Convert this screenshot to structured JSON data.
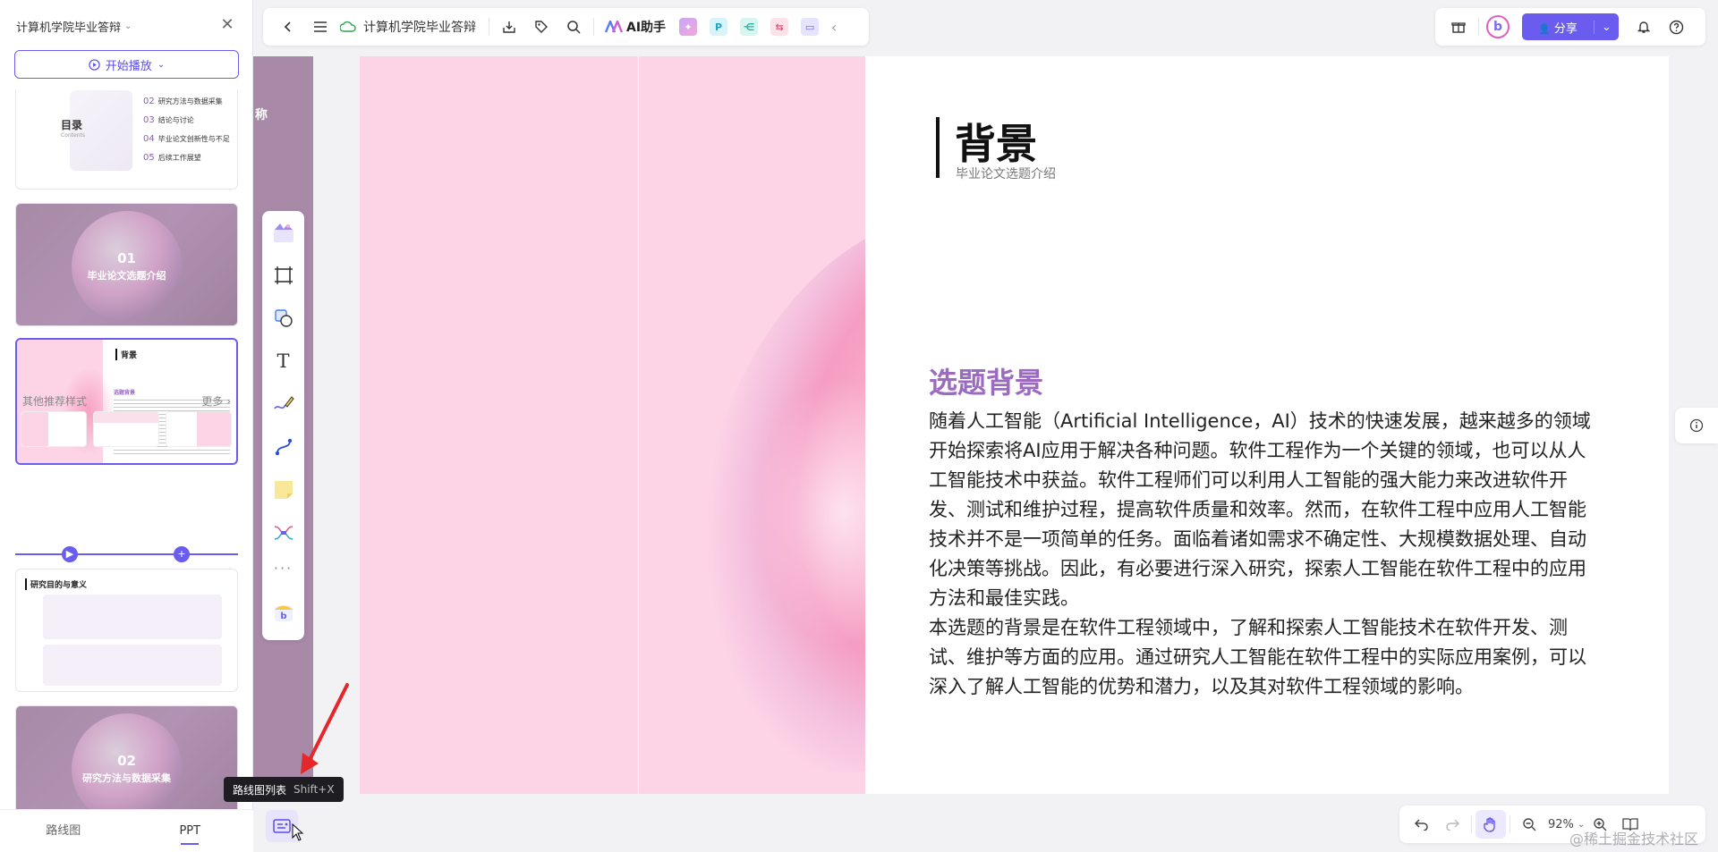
{
  "sidebar": {
    "title": "计算机学院毕业答辩",
    "play_label": "开始播放",
    "toc": {
      "title": "目录",
      "subtitle": "Contents",
      "items": [
        {
          "num": "02",
          "label": "研究方法与数据采集"
        },
        {
          "num": "03",
          "label": "结论与讨论"
        },
        {
          "num": "04",
          "label": "毕业论文创新性与不足"
        },
        {
          "num": "05",
          "label": "后续工作展望"
        }
      ]
    },
    "slide_01": {
      "num": "01",
      "label": "毕业论文选题介绍"
    },
    "slide_active": {
      "title": "背景",
      "section": "选题背景"
    },
    "recommend": {
      "label": "其他推荐样式",
      "more": "更多"
    },
    "slide_purpose": {
      "title": "研究目的与意义"
    },
    "slide_02": {
      "num": "02",
      "label": "研究方法与数据采集"
    },
    "tabs": [
      "路线图",
      "PPT"
    ]
  },
  "topbar": {
    "doc_title": "计算机学院毕业答辩",
    "ai_label": "AI助手"
  },
  "topright": {
    "share_label": "分享",
    "avatar_letter": "b"
  },
  "slide": {
    "strip_char": "称",
    "title": "背景",
    "subtitle": "毕业论文选题介绍",
    "section_title": "选题背景",
    "paragraphs": [
      "随着人工智能（Artificial Intelligence，AI）技术的快速发展，越来越多的领域开始探索将AI应用于解决各种问题。软件工程作为一个关键的领域，也可以从人工智能技术中获益。软件工程师们可以利用人工智能的强大能力来改进软件开发、测试和维护过程，提高软件质量和效率。然而，在软件工程中应用人工智能技术并不是一项简单的任务。面临着诸如需求不确定性、大规模数据处理、自动化决策等挑战。因此，有必要进行深入研究，探索人工智能在软件工程中的应用方法和最佳实践。",
      "本选题的背景是在软件工程领域中，了解和探索人工智能技术在软件开发、测试、维护等方面的应用。通过研究人工智能在软件工程中的实际应用案例，可以深入了解人工智能的优势和潜力，以及其对软件工程领域的影响。"
    ]
  },
  "tooltip": {
    "label": "路线图列表",
    "shortcut": "Shift+X"
  },
  "zoom": {
    "value": "92%"
  },
  "watermark": "@稀土掘金技术社区",
  "colors": {
    "accent": "#6b5cf0",
    "slide_pink": "#fdd4e6",
    "section_purple": "#9b6bbf",
    "slide_mauve": "#a88aa8"
  },
  "icons": {
    "back": "chevron-left-icon",
    "menu": "menu-icon",
    "cloud": "cloud-icon",
    "download": "download-icon",
    "tag": "tag-icon",
    "search": "search-icon"
  }
}
